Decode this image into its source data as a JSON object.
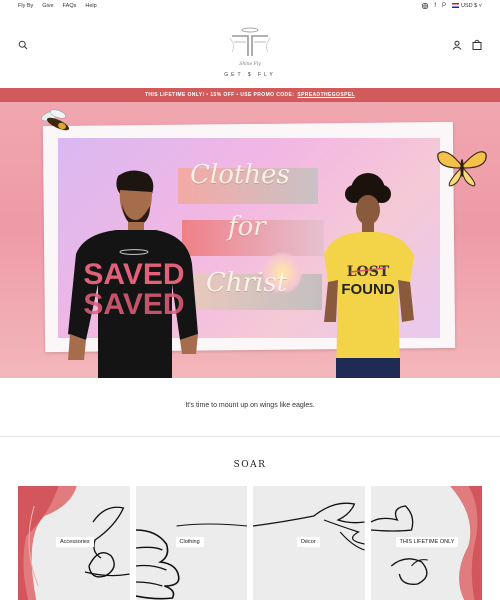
{
  "topbar": {
    "nav": [
      "Fly By",
      "Give",
      "FAQs",
      "Help"
    ],
    "social_icons": [
      "instagram-icon",
      "facebook-icon",
      "pinterest-icon"
    ],
    "currency": "USD $"
  },
  "header": {
    "tagline": "GET $ FLY",
    "logo_text": "Shine Fly"
  },
  "promo": {
    "text": "THIS LIFETIME ONLY! • 15% OFF • USE PROMO CODE:",
    "code": "SPREADTHEGOSPEL"
  },
  "hero": {
    "script_lines": [
      "Clothes",
      "for",
      "Christ"
    ],
    "shirt_left": "SAVED",
    "shirt_right_top": "LOST",
    "shirt_right_bottom": "FOUND"
  },
  "tagline": "It's time to mount up on wings like eagles.",
  "section_title": "SOAR",
  "categories": [
    {
      "label": "Accessories"
    },
    {
      "label": "Clothing"
    },
    {
      "label": "Décor"
    },
    {
      "label": "THIS LIFETIME ONLY"
    }
  ],
  "colors": {
    "promo_bg": "#d35a5a",
    "hero_bg": "#ee9aa7",
    "accent": "#d35a5a"
  }
}
